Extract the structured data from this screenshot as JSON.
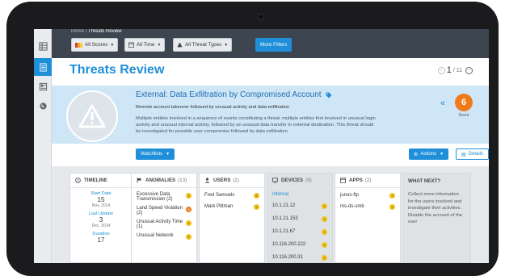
{
  "breadcrumb": {
    "home": "Home",
    "separator": "/",
    "current": "Threats Review"
  },
  "filters": {
    "scores": "All Scores",
    "time": "All Time",
    "threat_types": "All Threat Types",
    "more": "More Filters"
  },
  "page": {
    "title": "Threats Review"
  },
  "pager": {
    "current": "1",
    "total": "/ 11"
  },
  "threat": {
    "title": "External: Data Exfiltration by Compromised Account",
    "subtitle": "Remote account takeover followed by unusual activity and data exfiltration",
    "description": "Multiple entities involved in a sequence of events constituting a threat: multiple entities first involved in unusual login activity and unusual internal activity, followed by an unusual data transfer to external destination. This threat should be investigated for possible user compromise followed by data exfiltration.",
    "score": "6",
    "score_label": "Score"
  },
  "buttons": {
    "watchlists": "Watchlists",
    "actions": "Actions",
    "details": "Details"
  },
  "timeline": {
    "title": "TIMELINE",
    "start_label": "Start Date",
    "start_day": "15",
    "start_month": "Nov, 2014",
    "update_label": "Last Update",
    "update_day": "3",
    "update_month": "Dec, 2014",
    "duration_label": "Duration",
    "duration_value": "17"
  },
  "anomalies": {
    "title": "ANOMALIES",
    "count": "(13)",
    "items": [
      {
        "label": "Excessive Data Transmission",
        "count": "(2)",
        "score": "3"
      },
      {
        "label": "Land Speed Violation",
        "count": "(2)",
        "score": "5"
      },
      {
        "label": "Unusual Activity Time",
        "count": "(1)",
        "score": "3"
      },
      {
        "label": "Unusual Network",
        "count": "",
        "score": "3"
      }
    ]
  },
  "users": {
    "title": "USERS",
    "count": "(2)",
    "items": [
      {
        "label": "Fred Samuels",
        "score": "3"
      },
      {
        "label": "Mark Pittman",
        "score": "3"
      }
    ]
  },
  "devices": {
    "title": "DEVICES",
    "count": "(9)",
    "group": "Internal",
    "items": [
      {
        "label": "10.1.21.12",
        "score": "3"
      },
      {
        "label": "10.1.21.153",
        "score": "3"
      },
      {
        "label": "10.1.21.67",
        "score": "3"
      },
      {
        "label": "10.116.200.222",
        "score": "3"
      },
      {
        "label": "10.116.200.31",
        "score": "3"
      }
    ]
  },
  "apps": {
    "title": "APPS",
    "count": "(2)",
    "items": [
      {
        "label": "junos-ftp",
        "score": "3"
      },
      {
        "label": "ms-ds-smb",
        "score": "3"
      }
    ]
  },
  "next": {
    "title": "WHAT NEXT?",
    "text": "Collect more information for the users involved and investigate their activities. Disable the account of the user"
  },
  "colors": {
    "accent": "#1e8fd8",
    "score": "#ef7a1a",
    "low_score": "#f1c21b",
    "topbar": "#3d4650",
    "threat_bg": "#cfe6f6"
  }
}
